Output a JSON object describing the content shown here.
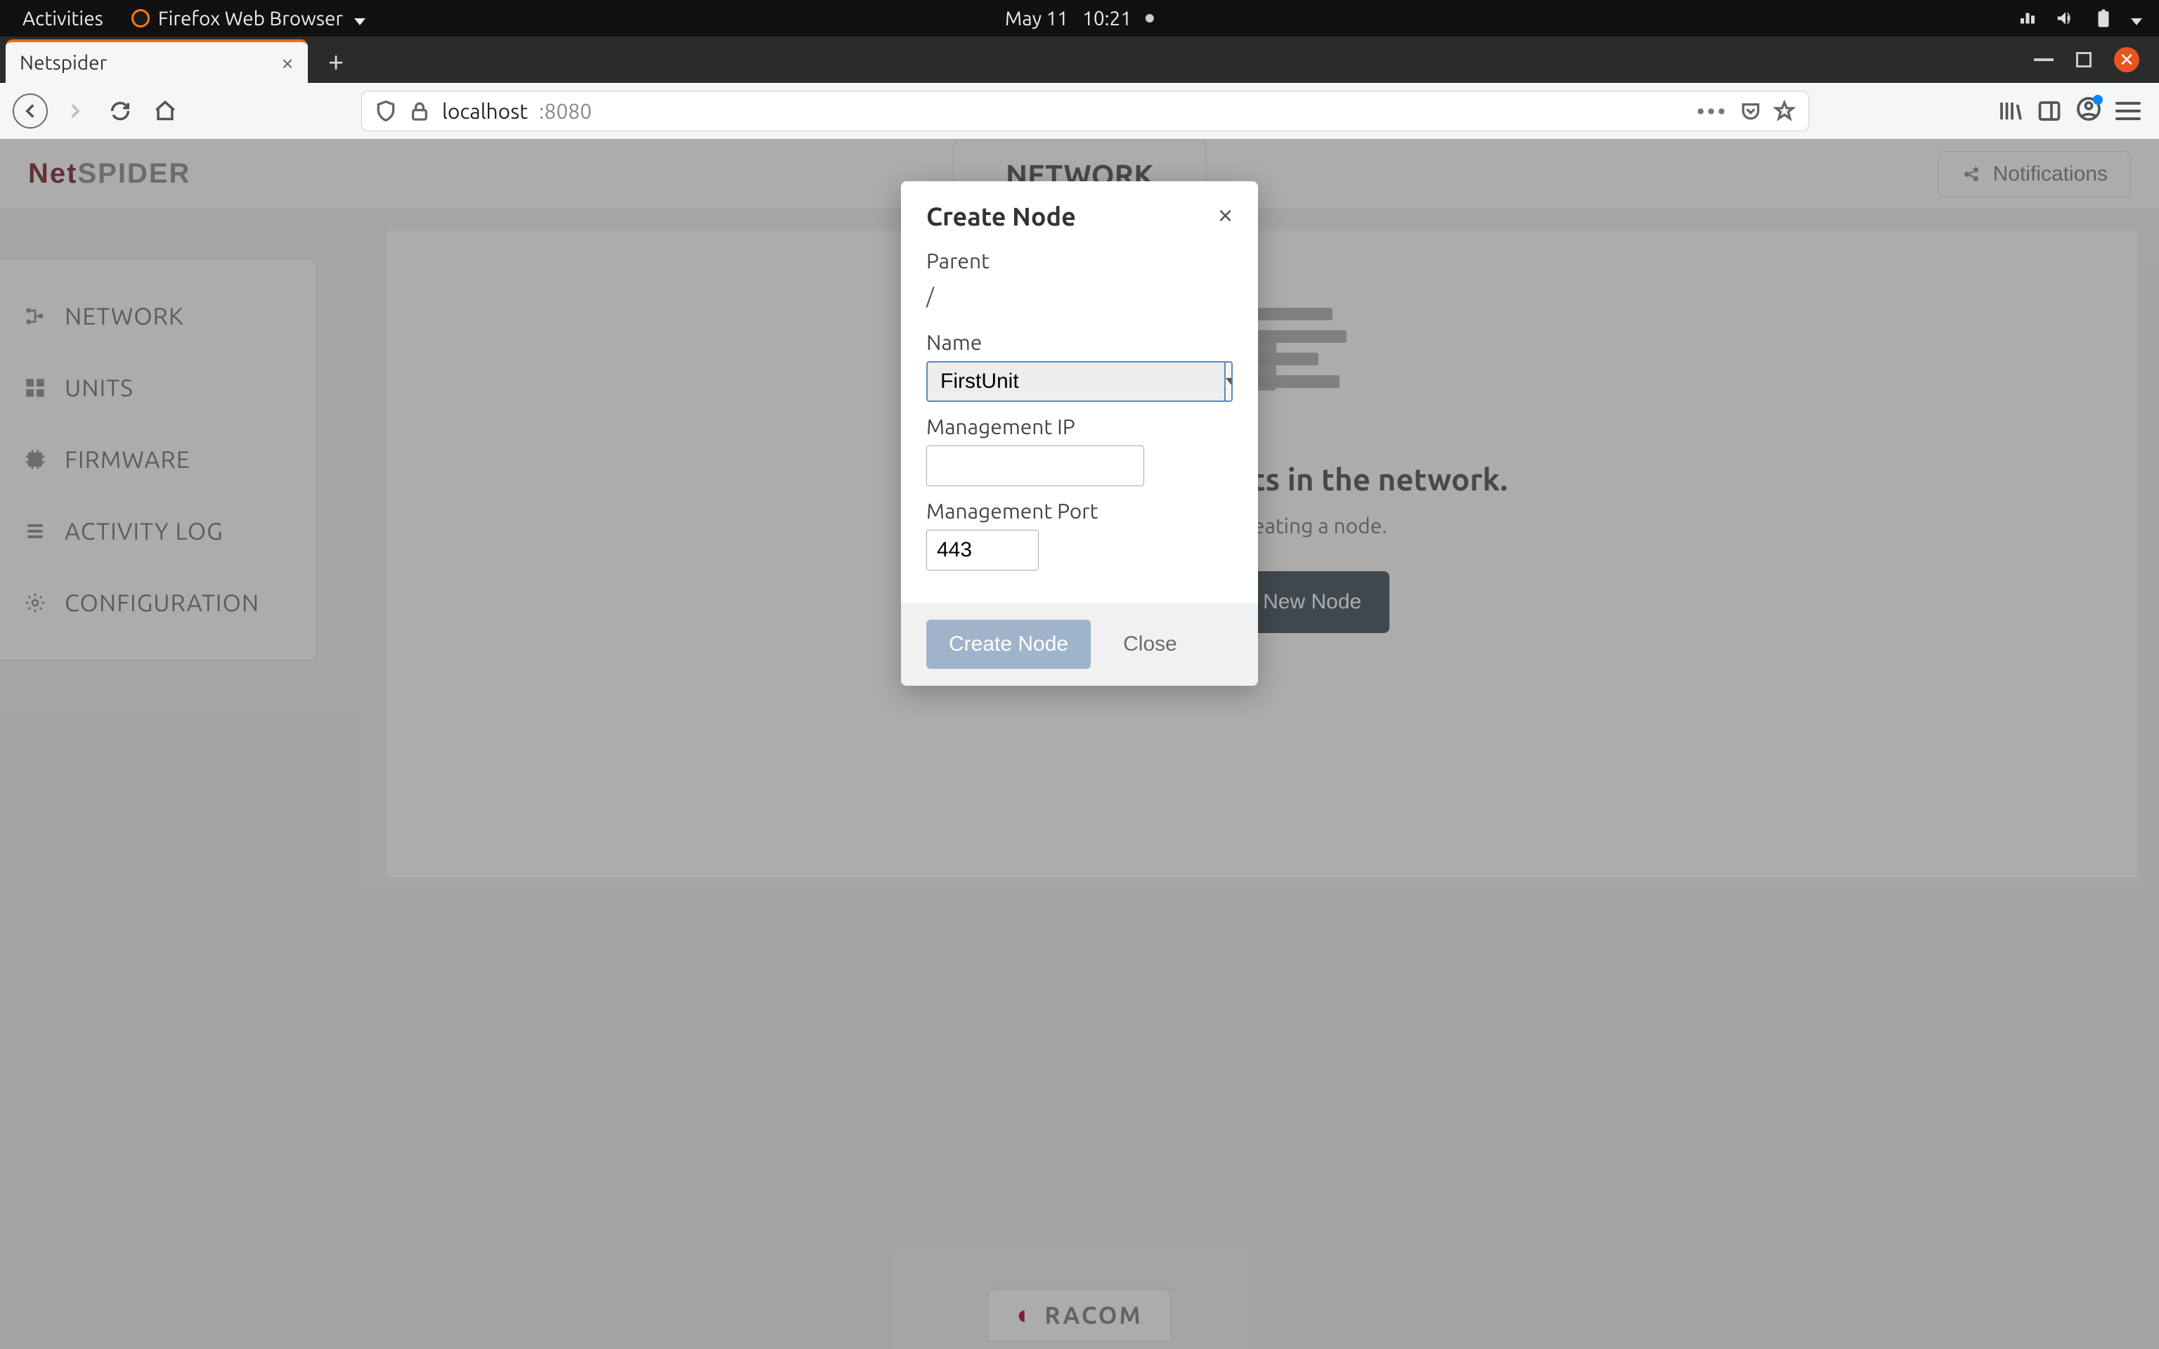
{
  "os": {
    "activities": "Activities",
    "app_name": "Firefox Web Browser",
    "date": "May 11",
    "time": "10:21"
  },
  "browser": {
    "tab_title": "Netspider",
    "url_host": "localhost",
    "url_port": ":8080"
  },
  "app": {
    "logo_net": "Net",
    "logo_spider": "SPIDER",
    "header_tab": "NETWORK",
    "notifications": "Notifications",
    "sidebar": {
      "items": [
        {
          "label": "NETWORK"
        },
        {
          "label": "UNITS"
        },
        {
          "label": "FIRMWARE"
        },
        {
          "label": "ACTIVITY LOG"
        },
        {
          "label": "CONFIGURATION"
        }
      ]
    },
    "empty": {
      "title": "There are no units in the network.",
      "subtitle": "Start with creating a node.",
      "button": "Create New Node"
    },
    "footer_brand": "RACOM"
  },
  "modal": {
    "title": "Create Node",
    "labels": {
      "parent": "Parent",
      "name": "Name",
      "ip": "Management IP",
      "port": "Management Port"
    },
    "values": {
      "parent": "/",
      "name": "FirstUnit",
      "ip": "",
      "port": "443"
    },
    "buttons": {
      "submit": "Create Node",
      "close": "Close"
    }
  }
}
